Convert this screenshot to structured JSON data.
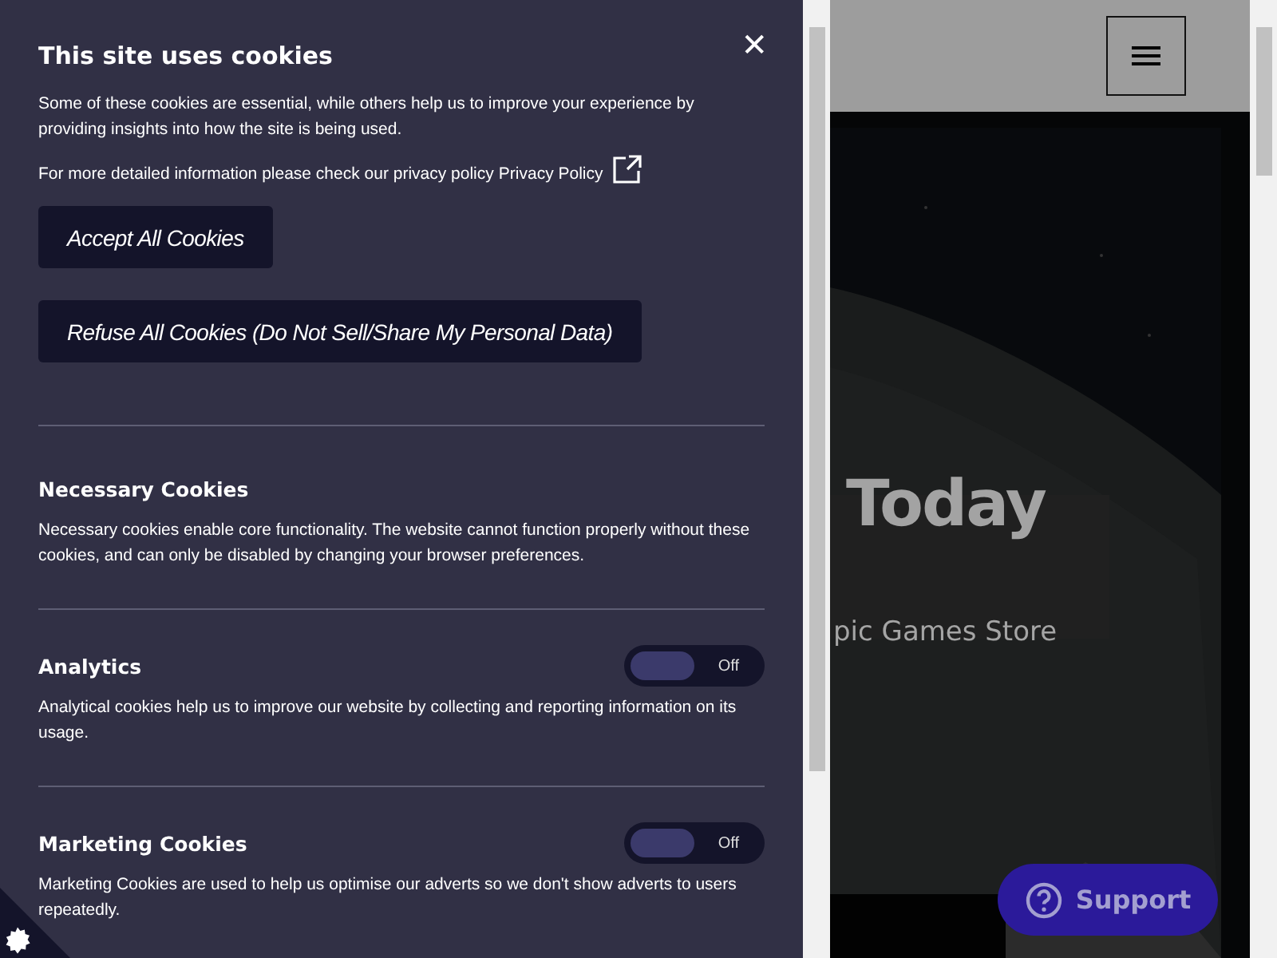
{
  "cookie_panel": {
    "title": "This site uses cookies",
    "close": "✕",
    "intro": "Some of these cookies are essential, while others help us to improve your experience by providing insights into how the site is being used.",
    "policy_text": "For more detailed information please check our privacy policy",
    "policy_link": "Privacy Policy",
    "buttons": [
      "Accept All Cookies",
      "Refuse All Cookies (Do Not Sell/Share My Personal Data)"
    ],
    "sections": [
      {
        "kind": "fixed",
        "title": "Necessary Cookies",
        "description": "Necessary cookies enable core functionality. The website cannot function properly without these cookies, and can only be disabled by changing your browser preferences."
      },
      {
        "kind": "toggle",
        "title": "Analytics",
        "description": "Analytical cookies help us to improve our website by collecting and reporting information on its usage.",
        "on": false,
        "state_label": "Off"
      },
      {
        "kind": "toggle",
        "title": "Marketing Cookies",
        "description": "Marketing Cookies are used to help us optimise our adverts so we don't show adverts to users repeatedly.",
        "on": false,
        "state_label": "Off"
      }
    ]
  },
  "page": {
    "hero_title": "Today",
    "hero_subtitle": "pic Games Store",
    "support_button": "Support"
  }
}
